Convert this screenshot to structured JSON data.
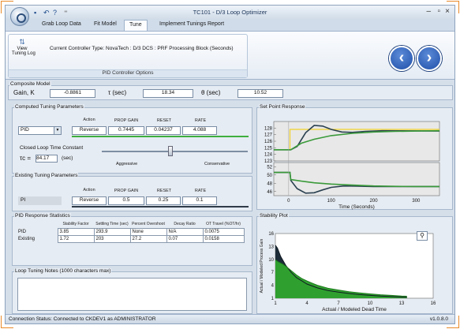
{
  "window": {
    "title": "TC101 - D/3 Loop Optimizer",
    "controls": [
      "–",
      "▫",
      "×"
    ]
  },
  "tabs": [
    "Grab Loop Data",
    "Fit Model",
    "Tune",
    "Implement Tunings",
    "Report"
  ],
  "selected_tab": "Tune",
  "ribbon": {
    "view_log_label_1": "View",
    "view_log_label_2": "Tuning Log",
    "controller_type": "Current Controller Type: NovaTech : D/3 DCS : PRF Processing Block (Seconds)",
    "group_caption": "PID Controller Options"
  },
  "composite": {
    "legend": "Composite Model",
    "gain_label": "Gain, K",
    "gain": "-0.8861",
    "tau_label": "τ (sec)",
    "tau": "18.34",
    "theta_label": "θ (sec)",
    "theta": "10.52"
  },
  "computed": {
    "legend": "Computed Tuning Parameters",
    "headers": [
      "Action",
      "PROP GAIN",
      "RESET",
      "RATE"
    ],
    "controller": "PID",
    "action": "Reverse",
    "prop_gain": "0.7445",
    "reset": "0.04237",
    "rate": "4.088",
    "clt_label": "Closed Loop Time Constant",
    "tc_label": "τc =",
    "tc_value": "84.17",
    "tc_unit": "(sec)",
    "aggressive": "Aggressive",
    "conservative": "Conservative",
    "slider_fraction": 0.47
  },
  "existing": {
    "legend": "Existing Tuning Parameters",
    "headers": [
      "Action",
      "PROP GAIN",
      "RESET",
      "RATE"
    ],
    "controller": "PI",
    "action": "Reverse",
    "prop_gain": "0.5",
    "reset": "0.25",
    "rate": "0.1"
  },
  "stats": {
    "legend": "PID Response Statistics",
    "headers": [
      "Stability Factor",
      "Settling Time (sec)",
      "Percent Overshoot",
      "Decay Ratio",
      "OT Travel (%OT/hr)"
    ],
    "rows": [
      {
        "label": "PID",
        "values": [
          "3.85",
          "293.9",
          "None",
          "N/A",
          "0.0075"
        ]
      },
      {
        "label": "Existing",
        "values": [
          "1.72",
          "203",
          "27.2",
          "0.07",
          "0.0158"
        ]
      }
    ]
  },
  "notes": {
    "legend": "Loop Tuning Notes (1000 characters max)",
    "text": ""
  },
  "status": {
    "text": "Connection Status: Connected to CKDEV1 as ADMINISTRATOR",
    "version": "v1.0.8.0"
  },
  "colors": {
    "accent": "#e88b2a",
    "pid_line": "#3a9a3a",
    "existing_line": "#2a4050",
    "setpoint": "#f2d22a",
    "plot_bg": "#e8e8e8"
  },
  "chart_data": [
    {
      "title": "Set Point Response",
      "type": "line",
      "xlabel": "Time (Seconds)",
      "ylabel": "",
      "xlim": [
        -35,
        355
      ],
      "x_ticks": [
        0,
        100,
        200,
        300
      ],
      "panels": [
        {
          "ylim": [
            123,
            129
          ],
          "y_ticks": [
            123,
            124,
            125,
            126,
            127,
            128
          ],
          "series": [
            {
              "kind": "setpoint",
              "x": [
                -35,
                3,
                3,
                355
              ],
              "y": [
                124.7,
                124.7,
                127.8,
                127.8
              ]
            },
            {
              "kind": "existing",
              "x": [
                -35,
                5,
                20,
                40,
                60,
                80,
                100,
                125,
                150,
                180,
                220,
                355
              ],
              "y": [
                124.7,
                124.7,
                125.2,
                127.3,
                128.4,
                128.3,
                127.8,
                127.4,
                127.35,
                127.5,
                127.6,
                127.55
              ]
            },
            {
              "kind": "pid",
              "x": [
                -35,
                5,
                30,
                60,
                100,
                150,
                200,
                250,
                300,
                355
              ],
              "y": [
                124.7,
                124.7,
                125.7,
                126.3,
                126.85,
                127.2,
                127.4,
                127.5,
                127.55,
                127.6
              ]
            }
          ]
        },
        {
          "ylim": [
            45,
            53
          ],
          "y_ticks": [
            46,
            48,
            50,
            52
          ],
          "series": [
            {
              "kind": "existing",
              "x": [
                -35,
                3,
                5,
                20,
                40,
                60,
                80,
                100,
                130,
                160,
                200,
                355
              ],
              "y": [
                50.6,
                50.6,
                48.7,
                46.7,
                45.6,
                45.7,
                46.4,
                47.0,
                47.35,
                47.3,
                47.2,
                47.2
              ]
            },
            {
              "kind": "pid",
              "x": [
                -35,
                3,
                5,
                30,
                60,
                100,
                150,
                200,
                250,
                300,
                355
              ],
              "y": [
                50.6,
                50.6,
                48.9,
                48.5,
                48.1,
                47.8,
                47.55,
                47.35,
                47.25,
                47.2,
                47.2
              ]
            }
          ]
        }
      ]
    },
    {
      "title": "Stability Plot",
      "type": "area",
      "xlabel": "Actual / Modeled Dead Time",
      "ylabel": "Actual / Modeled Process Gain",
      "xlim": [
        1,
        16
      ],
      "ylim": [
        1,
        16
      ],
      "x_ticks": [
        1,
        4,
        7,
        10,
        13,
        16
      ],
      "y_ticks": [
        1,
        4,
        7,
        10,
        13,
        16
      ],
      "series": [
        {
          "kind": "existing",
          "x": [
            1,
            1.2,
            1.5,
            2,
            2.5,
            3,
            4,
            5,
            6,
            7,
            8,
            9,
            10,
            11,
            12,
            13,
            13.5
          ],
          "y": [
            13.3,
            12.6,
            10.7,
            8.6,
            7.0,
            5.8,
            4.3,
            3.4,
            2.8,
            2.4,
            2.1,
            1.85,
            1.65,
            1.5,
            1.38,
            1.28,
            1.24
          ]
        },
        {
          "kind": "pid",
          "x": [
            1,
            1.3,
            1.7,
            2,
            2.5,
            3,
            3.5,
            4,
            4.5,
            5,
            6,
            7,
            8,
            9,
            10,
            11,
            12,
            13,
            13.5
          ],
          "y": [
            9.9,
            9.4,
            8.9,
            8.4,
            7.4,
            6.4,
            5.6,
            5.0,
            4.5,
            4.0,
            3.3,
            2.9,
            2.5,
            2.25,
            2.0,
            1.8,
            1.65,
            1.5,
            1.45
          ]
        }
      ]
    }
  ]
}
